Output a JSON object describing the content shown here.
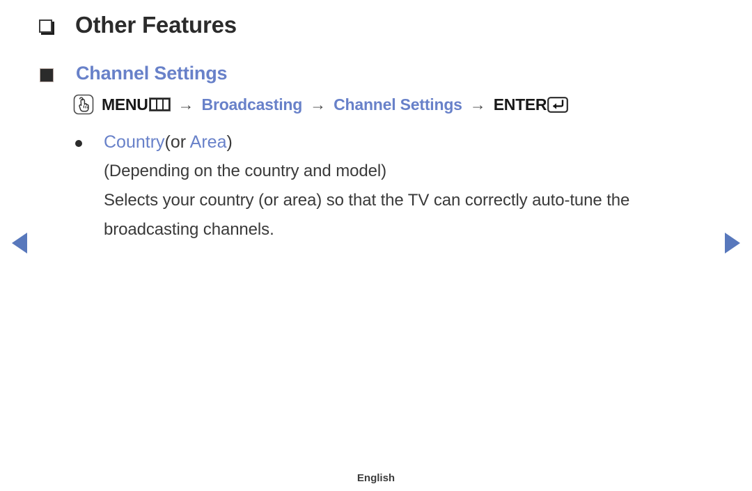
{
  "document": {
    "language_footer": "English"
  },
  "nav": {
    "prev_label": "previous-page-arrow",
    "next_label": "next-page-arrow"
  },
  "section": {
    "heading": "Other Features",
    "marker": "hollow-square-marker"
  },
  "topic": {
    "heading": "Channel Settings",
    "marker": "filled-square-marker"
  },
  "menu_path": {
    "press_icon": "hand-press-icon",
    "menu_label": "MENU",
    "menu_button_icon": "menu-button-icon",
    "arrow1": "→",
    "step1": "Broadcasting",
    "arrow2": "→",
    "step2": "Channel Settings",
    "arrow3": "→",
    "enter_label": "ENTER",
    "enter_button_icon": "enter-return-icon"
  },
  "item": {
    "bullet": "•",
    "name": "Country",
    "alt_prefix": "(or ",
    "alt_name": "Area",
    "alt_suffix": ")",
    "note": "(Depending on the country and model)",
    "description_line1": "Selects your country (or area) so that the TV can correctly auto-tune the",
    "description_line2": "broadcasting channels."
  },
  "colors": {
    "link_blue": "#6881c9",
    "nav_blue": "#5878bc",
    "text_dark": "#3a3a3a",
    "heading_dark": "#2b2b2b",
    "background": "#ffffff"
  }
}
